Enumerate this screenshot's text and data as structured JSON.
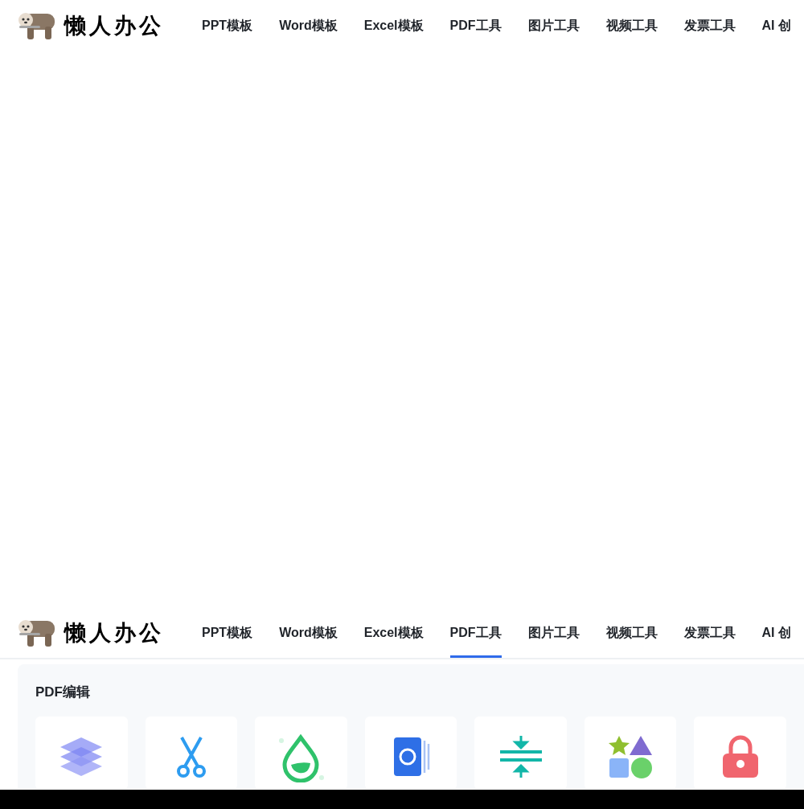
{
  "headers": [
    {
      "logo": "懒人办公",
      "nav": [
        {
          "label": "PPT模板",
          "selected": false
        },
        {
          "label": "Word模板",
          "selected": false
        },
        {
          "label": "Excel模板",
          "selected": false
        },
        {
          "label": "PDF工具",
          "selected": false
        },
        {
          "label": "图片工具",
          "selected": false
        },
        {
          "label": "视频工具",
          "selected": false
        },
        {
          "label": "发票工具",
          "selected": false
        },
        {
          "label": "AI 创",
          "selected": false
        }
      ]
    },
    {
      "logo": "懒人办公",
      "nav": [
        {
          "label": "PPT模板",
          "selected": false
        },
        {
          "label": "Word模板",
          "selected": false
        },
        {
          "label": "Excel模板",
          "selected": false
        },
        {
          "label": "PDF工具",
          "selected": true
        },
        {
          "label": "图片工具",
          "selected": false
        },
        {
          "label": "视频工具",
          "selected": false
        },
        {
          "label": "发票工具",
          "selected": false
        },
        {
          "label": "AI 创",
          "selected": false
        }
      ]
    }
  ],
  "panel": {
    "title": "PDF编辑",
    "tools": [
      {
        "kind": "layers"
      },
      {
        "kind": "scissors"
      },
      {
        "kind": "droplet"
      },
      {
        "kind": "book"
      },
      {
        "kind": "compress"
      },
      {
        "kind": "shapes"
      },
      {
        "kind": "lock"
      }
    ]
  }
}
